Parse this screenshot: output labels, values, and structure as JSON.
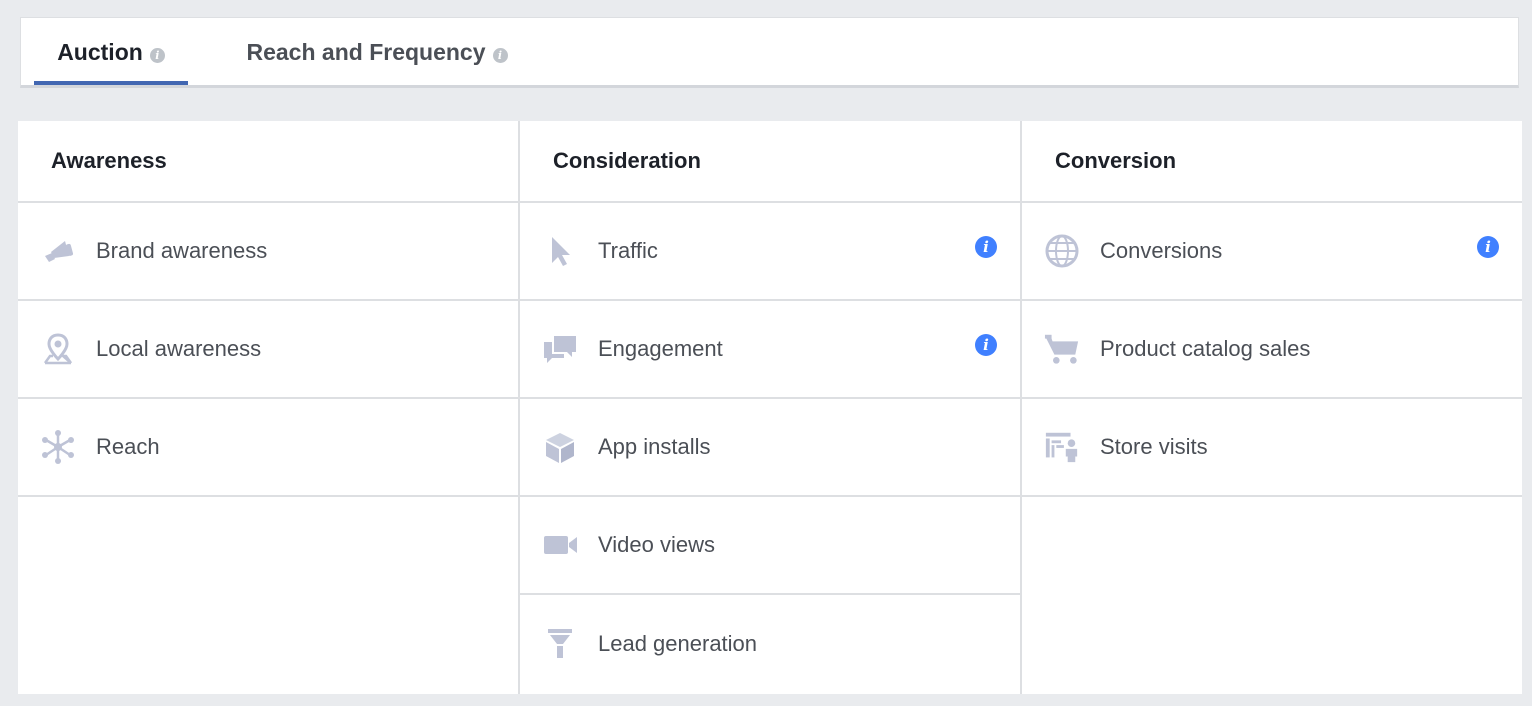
{
  "tabs": [
    {
      "label": "Auction",
      "active": true
    },
    {
      "label": "Reach and Frequency",
      "active": false
    }
  ],
  "columns": [
    {
      "title": "Awareness",
      "items": [
        {
          "label": "Brand awareness",
          "icon": "megaphone-icon",
          "info": false
        },
        {
          "label": "Local awareness",
          "icon": "map-pin-icon",
          "info": false
        },
        {
          "label": "Reach",
          "icon": "reach-network-icon",
          "info": false
        }
      ]
    },
    {
      "title": "Consideration",
      "items": [
        {
          "label": "Traffic",
          "icon": "cursor-icon",
          "info": true
        },
        {
          "label": "Engagement",
          "icon": "chat-bubbles-icon",
          "info": true
        },
        {
          "label": "App installs",
          "icon": "cube-icon",
          "info": false
        },
        {
          "label": "Video views",
          "icon": "video-camera-icon",
          "info": false
        },
        {
          "label": "Lead generation",
          "icon": "funnel-icon",
          "info": false
        }
      ]
    },
    {
      "title": "Conversion",
      "items": [
        {
          "label": "Conversions",
          "icon": "globe-icon",
          "info": true
        },
        {
          "label": "Product catalog sales",
          "icon": "shopping-cart-icon",
          "info": false
        },
        {
          "label": "Store visits",
          "icon": "storefront-icon",
          "info": false
        }
      ]
    }
  ],
  "info_glyph": "i",
  "colors": {
    "accent": "#4267b2",
    "info": "#4080ff",
    "icon": "#bec3d6",
    "background": "#e9ebee"
  }
}
